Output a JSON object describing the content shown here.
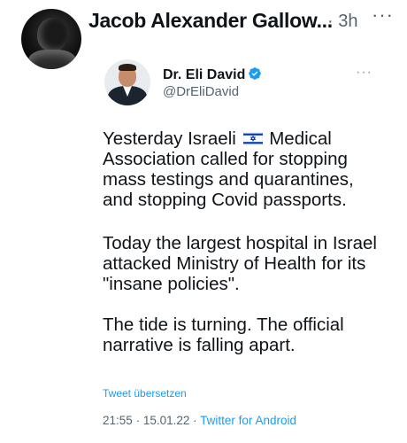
{
  "retweeter": {
    "name": "Jacob Alexander Gallow...",
    "time": "· 3h",
    "more_icon": "more-horizontal-icon"
  },
  "tweet": {
    "author_name": "Dr. Eli David",
    "handle": "@DrEliDavid",
    "verified_icon": "verified-badge-icon",
    "more_icon": "more-horizontal-icon",
    "paragraph1_before_flag": "Yesterday Israeli",
    "flag_icon": "israel-flag-icon",
    "paragraph1_after_flag": "Medical Association called for stopping mass testings and quarantines, and stopping Covid passports.",
    "paragraph2": "Today the largest hospital in Israel attacked Ministry of Health for its \"insane policies\".",
    "paragraph3": "The tide is turning. The official narrative is falling apart.",
    "translate_label": "Tweet übersetzen",
    "time": "21:55",
    "date": "15.01.22",
    "separator": "·",
    "source": "Twitter for Android"
  },
  "colors": {
    "link": "#1d9bf0",
    "secondary_text": "#536471",
    "verified": "#1d9bf0",
    "flag_blue": "#0038b8"
  }
}
